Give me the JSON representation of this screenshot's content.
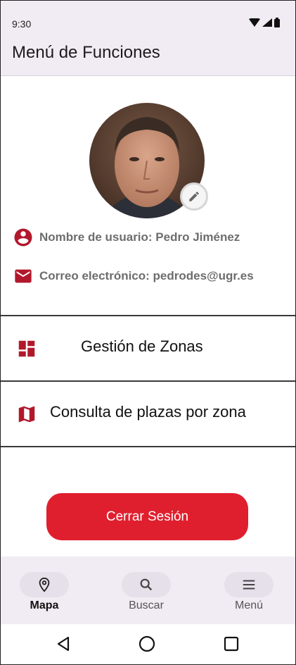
{
  "status_bar": {
    "time": "9:30"
  },
  "app_bar": {
    "title": "Menú de Funciones"
  },
  "profile": {
    "username_label": "Nombre de usuario: Pedro Jiménez",
    "email_label": "Correo electrónico: pedrodes@ugr.es"
  },
  "menu": {
    "items": [
      {
        "label": "Gestión de Zonas",
        "icon": "dashboard-icon"
      },
      {
        "label": "Consulta de plazas por zona",
        "icon": "map-icon"
      }
    ]
  },
  "logout_label": "Cerrar Sesión",
  "bottom_nav": {
    "items": [
      {
        "label": "Mapa",
        "icon": "location-pin-icon",
        "active": true
      },
      {
        "label": "Buscar",
        "icon": "search-icon",
        "active": false
      },
      {
        "label": "Menú",
        "icon": "menu-icon",
        "active": false
      }
    ]
  },
  "colors": {
    "accent": "#e01f2e",
    "icon_red": "#b2182b",
    "bar_bg": "#f1ebf3"
  }
}
